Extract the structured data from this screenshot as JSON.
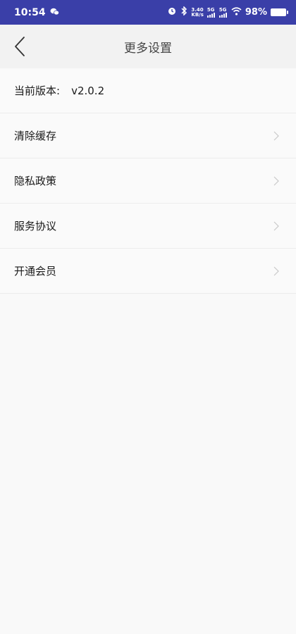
{
  "status_bar": {
    "time": "10:54",
    "net_speed_top": "3.40",
    "net_speed_bottom": "KB/s",
    "signal_1": "5G",
    "signal_2": "5G",
    "battery": "98%"
  },
  "nav": {
    "title": "更多设置"
  },
  "version": {
    "label": "当前版本:",
    "value": "v2.0.2"
  },
  "items": [
    {
      "label": "清除缓存"
    },
    {
      "label": "隐私政策"
    },
    {
      "label": "服务协议"
    },
    {
      "label": "开通会员"
    }
  ],
  "colors": {
    "status_bar_bg": "#3a3fa8",
    "nav_bg": "#f2f2f2",
    "page_bg": "#f7f7f7"
  }
}
